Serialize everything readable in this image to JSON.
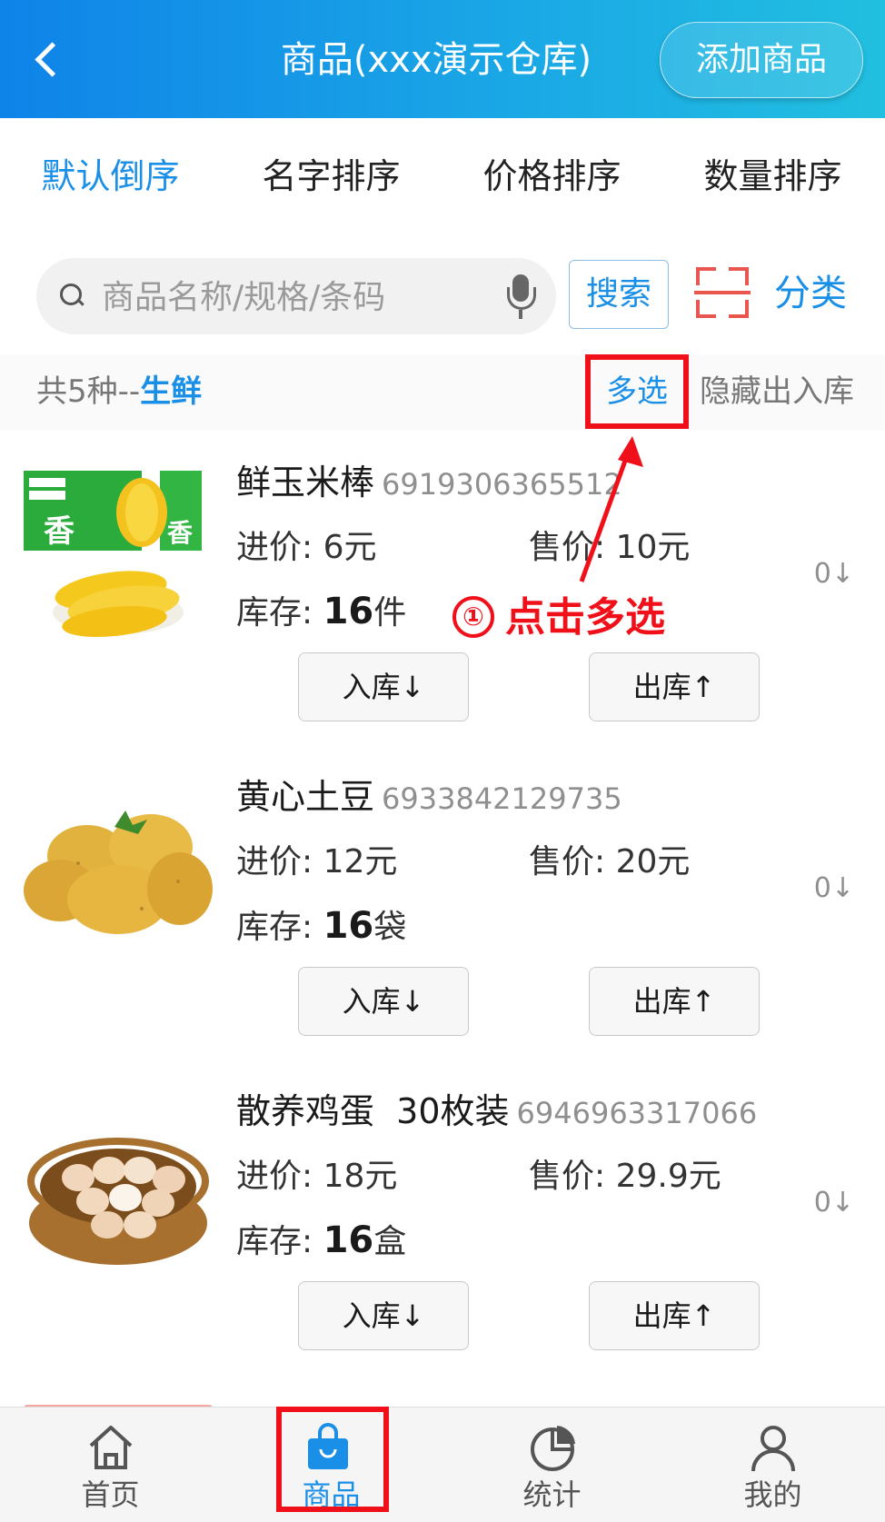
{
  "header": {
    "title": "商品(xxx演示仓库)",
    "add_button": "添加商品",
    "back_icon": "back-icon"
  },
  "sort": {
    "items": [
      "默认倒序",
      "名字排序",
      "价格排序",
      "数量排序"
    ],
    "active_index": 0
  },
  "search": {
    "placeholder": "商品名称/规格/条码",
    "button": "搜索",
    "category": "分类"
  },
  "info": {
    "count_prefix": "共5种--",
    "category_name": "生鲜",
    "multi_select": "多选",
    "hide_io": "隐藏出入库"
  },
  "annotation": {
    "step": "①",
    "text": "点击多选"
  },
  "products": [
    {
      "name": "鲜玉米棒",
      "code": "6919306365512",
      "cost": "进价: 6元",
      "price": "售价: 10元",
      "stock_label": "库存: ",
      "stock_value": "16",
      "stock_unit": "件",
      "qty": "0↓",
      "in_btn": "入库↓",
      "out_btn": "出库↑",
      "image": "corn"
    },
    {
      "name": "黄心土豆",
      "code": "6933842129735",
      "cost": "进价: 12元",
      "price": "售价: 20元",
      "stock_label": "库存: ",
      "stock_value": "16",
      "stock_unit": "袋",
      "qty": "0↓",
      "in_btn": "入库↓",
      "out_btn": "出库↑",
      "image": "potato"
    },
    {
      "name": "散养鸡蛋  30枚装",
      "code": "6946963317066",
      "cost": "进价: 18元",
      "price": "售价: 29.9元",
      "stock_label": "库存: ",
      "stock_value": "16",
      "stock_unit": "盒",
      "qty": "0↓",
      "in_btn": "入库↓",
      "out_btn": "出库↑",
      "image": "eggs"
    }
  ],
  "tabs": [
    {
      "label": "首页",
      "icon": "home-icon"
    },
    {
      "label": "商品",
      "icon": "bag-icon"
    },
    {
      "label": "统计",
      "icon": "pie-chart-icon"
    },
    {
      "label": "我的",
      "icon": "user-icon"
    }
  ],
  "active_tab": 1,
  "colors": {
    "accent": "#1a8fe8",
    "highlight": "#f0101a",
    "scan": "#e8564d"
  }
}
